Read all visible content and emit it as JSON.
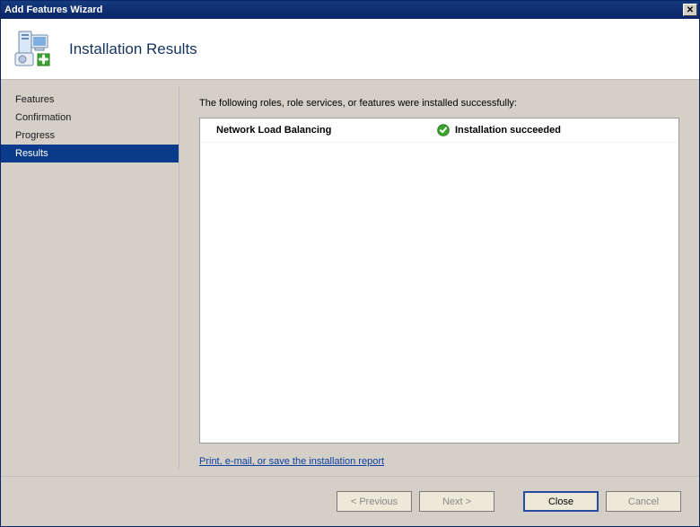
{
  "window": {
    "title": "Add Features Wizard"
  },
  "header": {
    "title": "Installation Results"
  },
  "sidebar": {
    "items": [
      {
        "label": "Features",
        "active": false
      },
      {
        "label": "Confirmation",
        "active": false
      },
      {
        "label": "Progress",
        "active": false
      },
      {
        "label": "Results",
        "active": true
      }
    ]
  },
  "main": {
    "intro": "The following roles, role services, or features were installed successfully:",
    "results": [
      {
        "feature": "Network Load Balancing",
        "status": "Installation succeeded"
      }
    ],
    "report_link": "Print, e-mail, or save the installation report"
  },
  "footer": {
    "previous": "< Previous",
    "next": "Next >",
    "close": "Close",
    "cancel": "Cancel"
  }
}
